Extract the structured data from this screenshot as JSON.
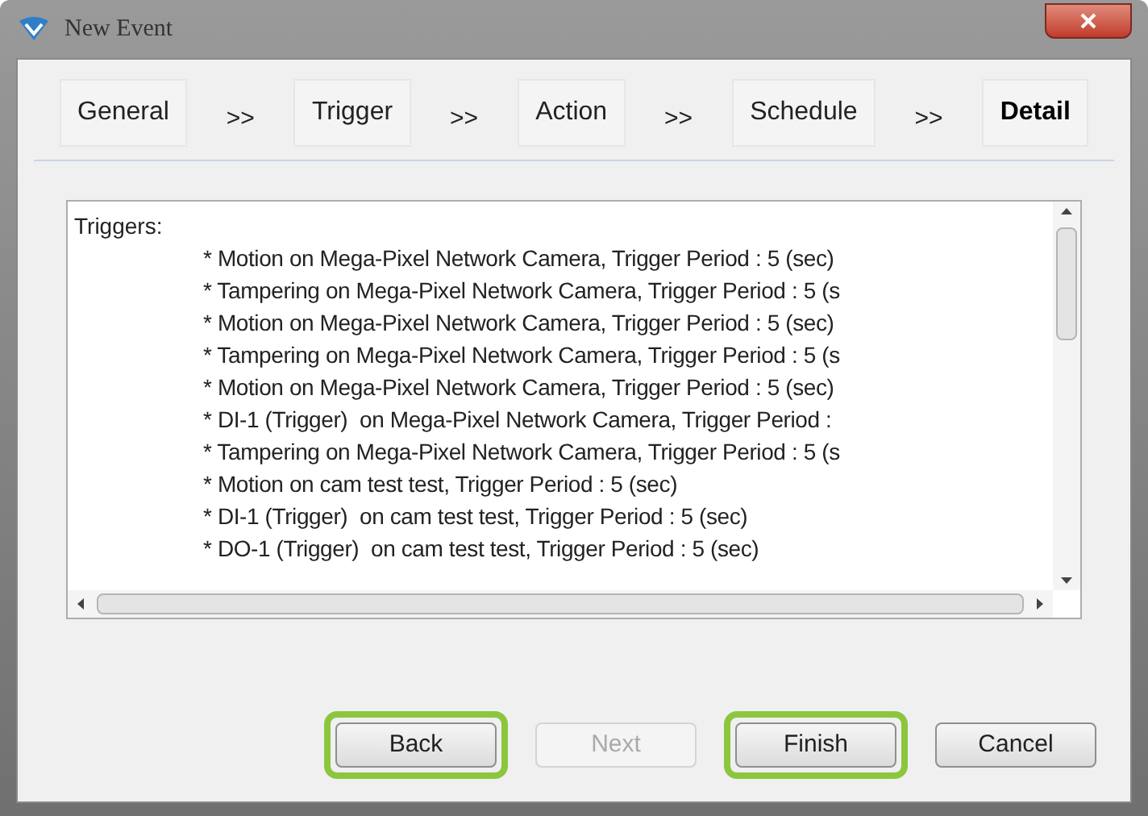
{
  "window": {
    "title": "New Event"
  },
  "steps": [
    {
      "label": "General",
      "selected": false
    },
    {
      "label": "Trigger",
      "selected": false
    },
    {
      "label": "Action",
      "selected": false
    },
    {
      "label": "Schedule",
      "selected": false
    },
    {
      "label": "Detail",
      "selected": true
    }
  ],
  "step_separator": ">>",
  "details": {
    "heading": "Triggers:",
    "lines": [
      "* Motion on Mega-Pixel Network Camera, Trigger Period : 5 (sec)",
      "* Tampering on Mega-Pixel Network Camera, Trigger Period : 5 (s",
      "* Motion on Mega-Pixel Network Camera, Trigger Period : 5 (sec)",
      "* Tampering on Mega-Pixel Network Camera, Trigger Period : 5 (s",
      "* Motion on Mega-Pixel Network Camera, Trigger Period : 5 (sec)",
      "* DI-1 (Trigger)  on Mega-Pixel Network Camera, Trigger Period :",
      "* Tampering on Mega-Pixel Network Camera, Trigger Period : 5 (s",
      "* Motion on cam test test, Trigger Period : 5 (sec)",
      "* DI-1 (Trigger)  on cam test test, Trigger Period : 5 (sec)",
      "* DO-1 (Trigger)  on cam test test, Trigger Period : 5 (sec)"
    ]
  },
  "buttons": [
    {
      "label": "Back",
      "disabled": false,
      "highlighted": true
    },
    {
      "label": "Next",
      "disabled": true,
      "highlighted": false
    },
    {
      "label": "Finish",
      "disabled": false,
      "highlighted": true
    },
    {
      "label": "Cancel",
      "disabled": false,
      "highlighted": false
    }
  ]
}
